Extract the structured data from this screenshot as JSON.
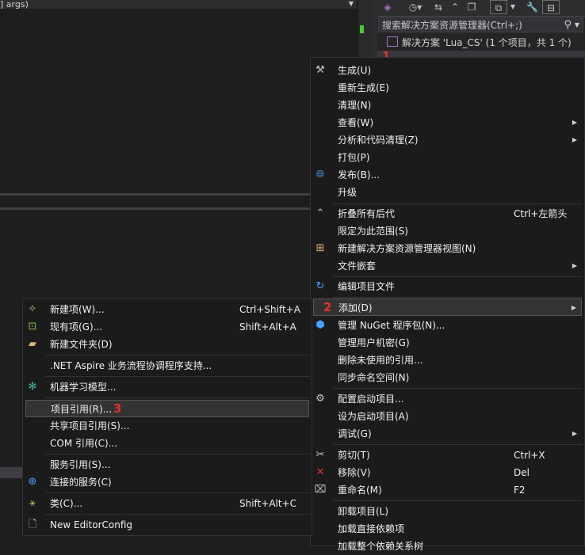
{
  "editor": {
    "code_dropdown": "] args)"
  },
  "solution_explorer": {
    "search_placeholder": "搜索解决方案资源管理器(Ctrl+;)",
    "solution_label": "解决方案 'Lua_CS' (1 个项目，共 1 个)",
    "toolbar_icons": [
      "vs-icon",
      "history-icon",
      "sync-icon",
      "collapse-icon",
      "copy-icon",
      "filter-icon",
      "wrench-icon",
      "preview-icon"
    ]
  },
  "main_menu": {
    "items": [
      {
        "label": "生成(U)",
        "icon": "build-icon"
      },
      {
        "label": "重新生成(E)"
      },
      {
        "label": "清理(N)"
      },
      {
        "label": "查看(W)",
        "submenu": true
      },
      {
        "label": "分析和代码清理(Z)",
        "submenu": true
      },
      {
        "label": "打包(P)"
      },
      {
        "label": "发布(B)...",
        "icon": "globe-icon"
      },
      {
        "label": "升级"
      },
      {
        "label": "折叠所有后代",
        "shortcut": "Ctrl+左箭头",
        "icon": "collapse-icon"
      },
      {
        "label": "限定为此范围(S)"
      },
      {
        "label": "新建解决方案资源管理器视图(N)",
        "icon": "new-view-icon"
      },
      {
        "label": "文件嵌套",
        "submenu": true
      },
      {
        "label": "编辑项目文件",
        "icon": "edit-file-icon"
      },
      {
        "label": "添加(D)",
        "submenu": true,
        "highlighted": true
      },
      {
        "label": "管理 NuGet 程序包(N)...",
        "icon": "nuget-icon"
      },
      {
        "label": "管理用户机密(G)"
      },
      {
        "label": "删除未使用的引用..."
      },
      {
        "label": "同步命名空间(N)"
      },
      {
        "label": "配置启动项目...",
        "icon": "gear-icon"
      },
      {
        "label": "设为启动项目(A)"
      },
      {
        "label": "调试(G)",
        "submenu": true
      },
      {
        "label": "剪切(T)",
        "shortcut": "Ctrl+X",
        "icon": "scissors-icon"
      },
      {
        "label": "移除(V)",
        "shortcut": "Del",
        "icon": "remove-icon"
      },
      {
        "label": "重命名(M)",
        "shortcut": "F2",
        "icon": "rename-icon"
      },
      {
        "label": "卸载项目(L)"
      },
      {
        "label": "加载直接依赖项"
      },
      {
        "label": "加载整个依赖关系树"
      }
    ]
  },
  "add_submenu": {
    "items": [
      {
        "label": "新建项(W)...",
        "shortcut": "Ctrl+Shift+A",
        "icon": "new-item-icon"
      },
      {
        "label": "现有项(G)...",
        "shortcut": "Shift+Alt+A",
        "icon": "existing-item-icon"
      },
      {
        "label": "新建文件夹(D)",
        "icon": "new-folder-icon"
      },
      {
        "label": ".NET Aspire 业务流程协调程序支持..."
      },
      {
        "label": "机器学习模型...",
        "icon": "ml-model-icon"
      },
      {
        "label": "项目引用(R)...",
        "highlighted": true
      },
      {
        "label": "共享项目引用(S)..."
      },
      {
        "label": "COM 引用(C)..."
      },
      {
        "label": "服务引用(S)..."
      },
      {
        "label": "连接的服务(C)",
        "icon": "connected-service-icon"
      },
      {
        "label": "类(C)...",
        "shortcut": "Shift+Alt+C",
        "icon": "class-icon"
      },
      {
        "label": "New EditorConfig",
        "icon": "editorconfig-icon"
      }
    ]
  },
  "annotations": {
    "step1": "1",
    "step2": "2",
    "step3": "3"
  },
  "colors": {
    "background": "#1e1e1e",
    "menu": "#1b1b1c",
    "highlight": "#333334",
    "annotation": "#e8302a"
  }
}
